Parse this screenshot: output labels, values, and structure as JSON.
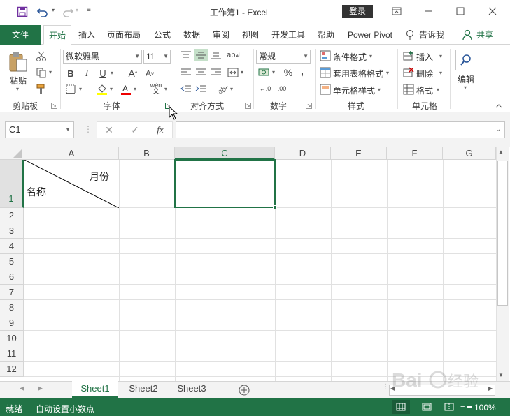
{
  "titlebar": {
    "title": "工作簿1  -  Excel",
    "login": "登录",
    "save_icon": "save-icon",
    "undo_icon": "undo-icon",
    "redo_icon": "redo-icon"
  },
  "tabs": [
    "文件",
    "开始",
    "插入",
    "页面布局",
    "公式",
    "数据",
    "审阅",
    "视图",
    "开发工具",
    "帮助",
    "Power Pivot",
    "告诉我",
    "共享"
  ],
  "ribbon": {
    "clipboard": {
      "paste": "粘贴",
      "label": "剪贴板"
    },
    "font": {
      "name": "微软雅黑",
      "size": "11",
      "bold": "B",
      "italic": "I",
      "underline": "U",
      "grow": "A",
      "shrink": "A",
      "label": "字体",
      "pinyin": "wén"
    },
    "alignment": {
      "label": "对齐方式",
      "abc": "ab"
    },
    "number": {
      "format": "常规",
      "percent": "%",
      "comma": ",",
      "label": "数字",
      "inc": "←.0",
      "dec": ".00"
    },
    "styles": {
      "cond": "条件格式",
      "table": "套用表格格式",
      "cell": "单元格样式",
      "label": "样式"
    },
    "cells": {
      "insert": "插入",
      "delete": "删除",
      "format": "格式",
      "label": "单元格"
    },
    "editing": {
      "label": "编辑"
    }
  },
  "formula_bar": {
    "name_box": "C1",
    "cancel": "✕",
    "enter": "✓",
    "fx": "fx"
  },
  "columns": [
    "A",
    "B",
    "C",
    "D",
    "E",
    "F",
    "G"
  ],
  "rows": [
    "1",
    "2",
    "3",
    "4",
    "5",
    "6",
    "7",
    "8",
    "9",
    "10",
    "11",
    "12"
  ],
  "cells": {
    "a1_top": "月份",
    "a1_bottom": "名称"
  },
  "sheets": [
    "Sheet1",
    "Sheet2",
    "Sheet3"
  ],
  "status": {
    "ready": "就绪",
    "decimal": "自动设置小数点",
    "zoom": "100%"
  },
  "colors": {
    "accent": "#217346"
  }
}
